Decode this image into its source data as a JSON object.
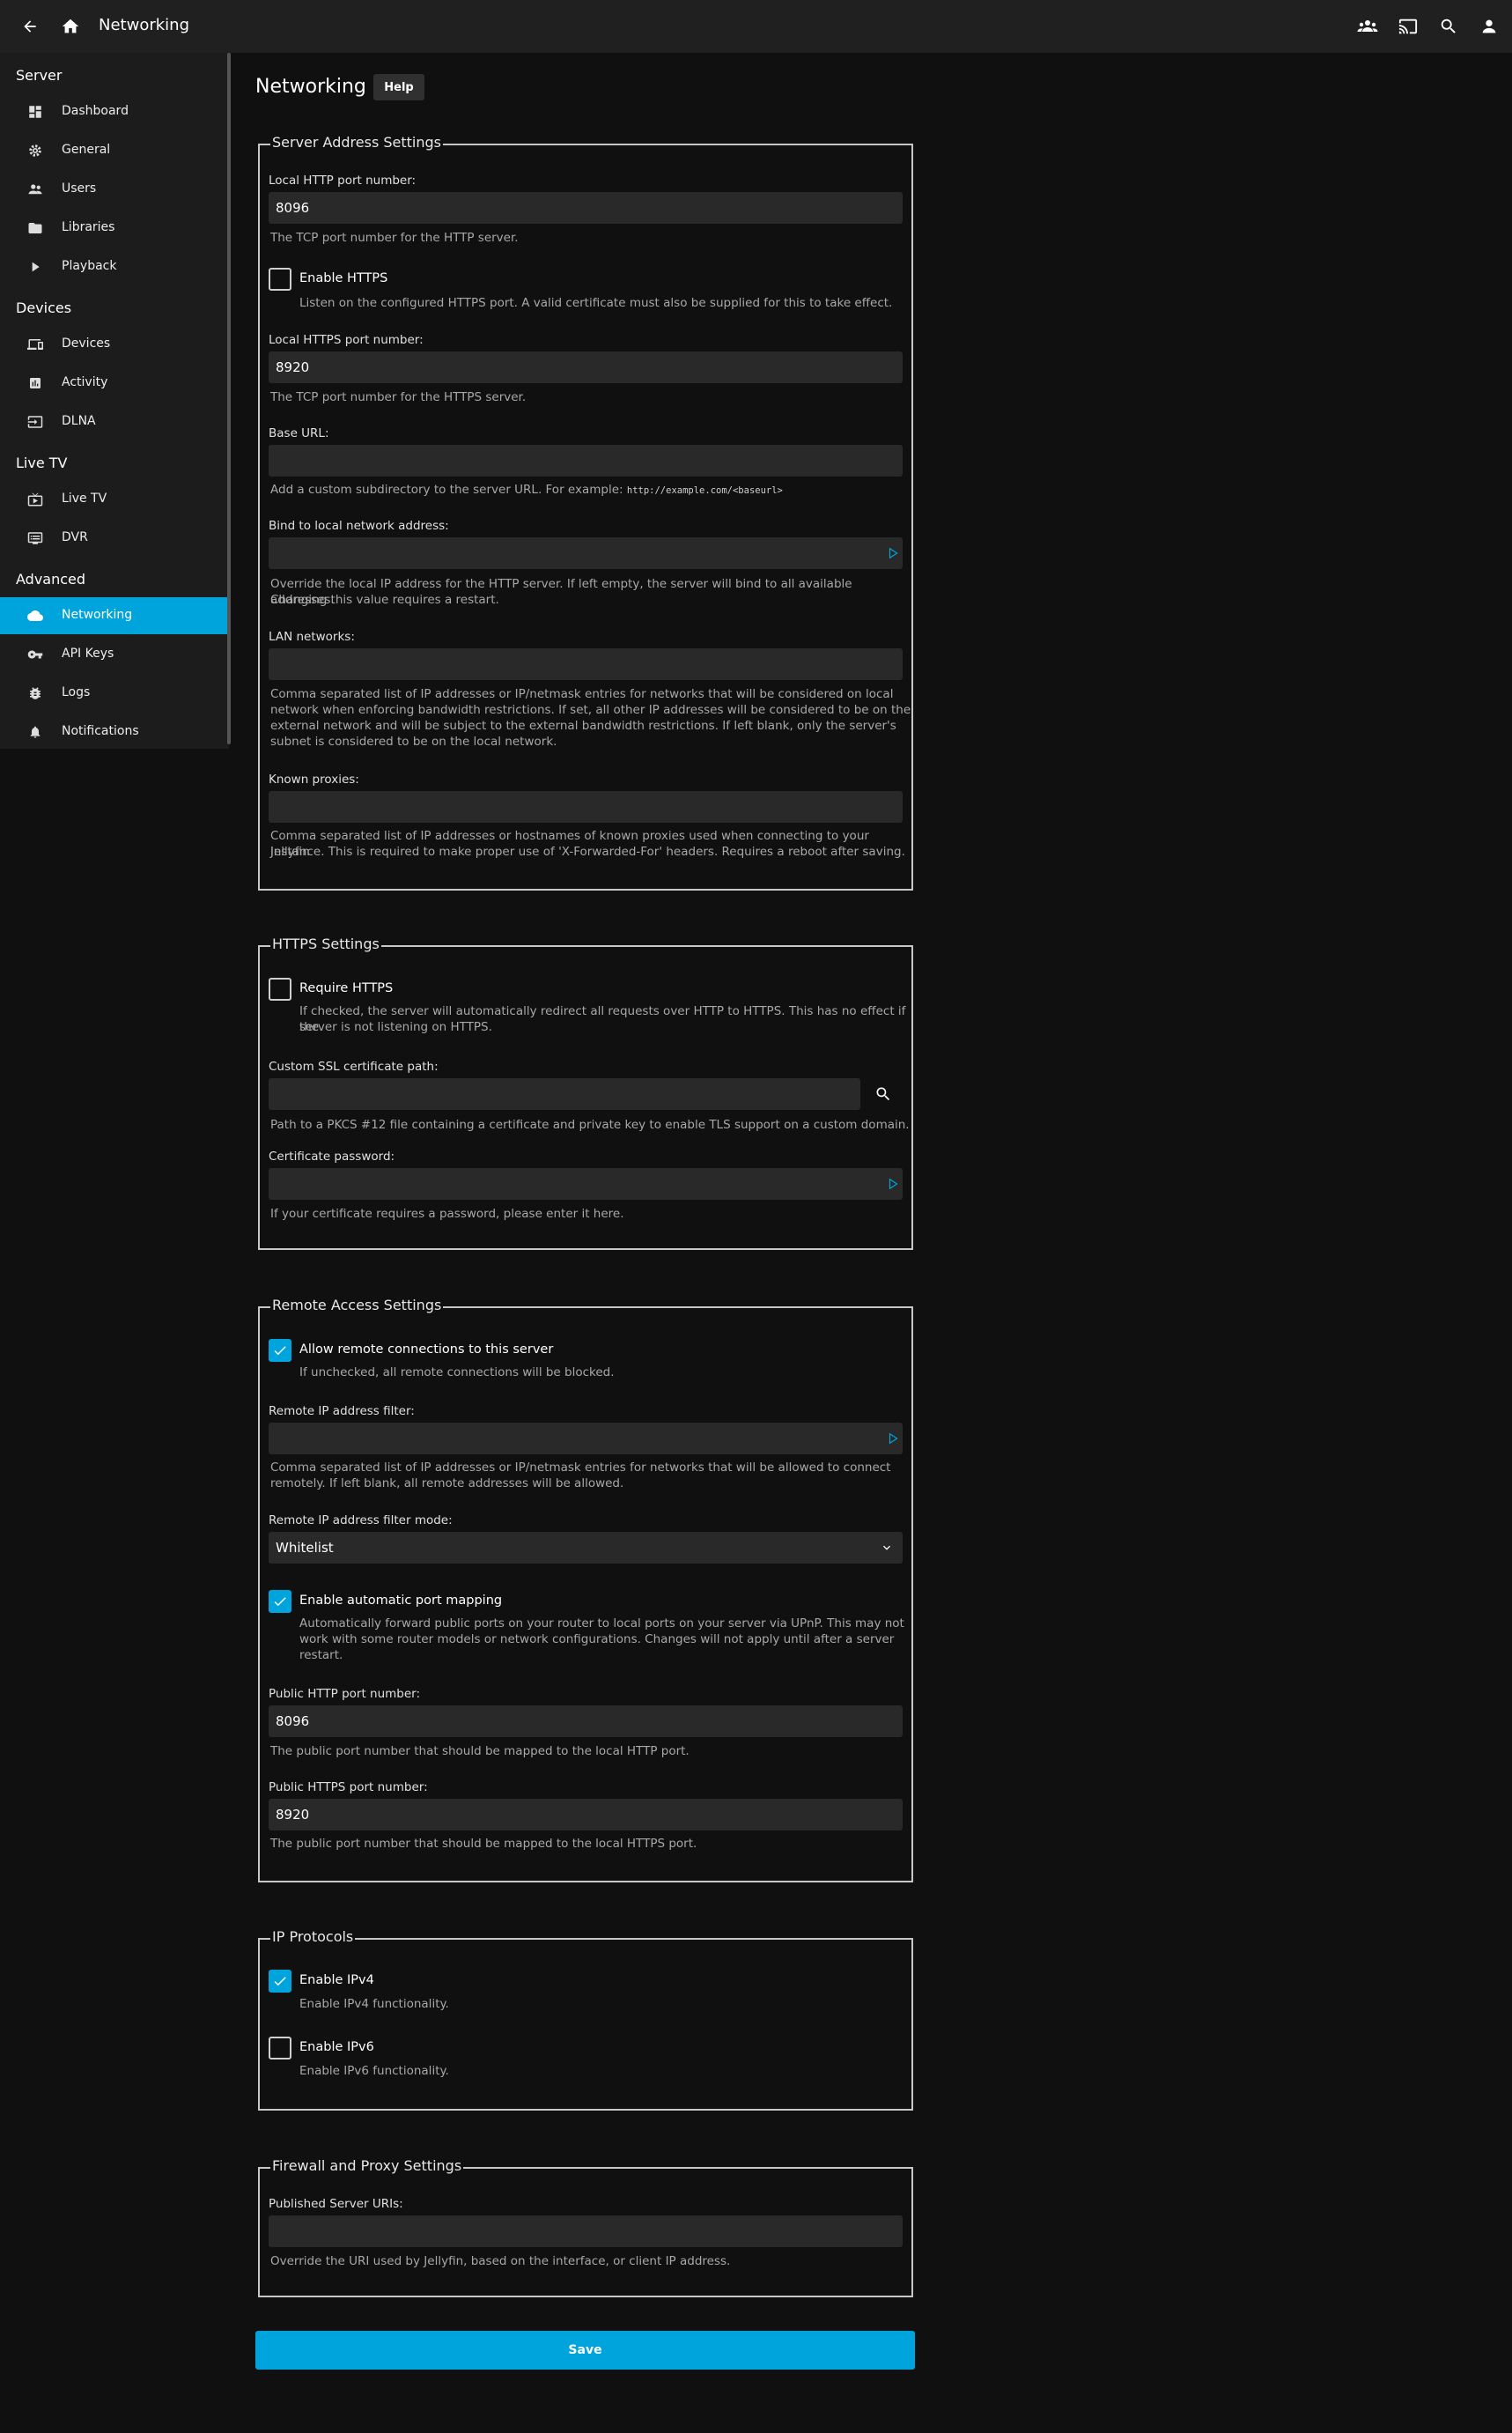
{
  "header": {
    "title": "Networking"
  },
  "sidebar": {
    "sections": [
      {
        "heading": "Server",
        "items": [
          "Dashboard",
          "General",
          "Users",
          "Libraries",
          "Playback"
        ]
      },
      {
        "heading": "Devices",
        "items": [
          "Devices",
          "Activity",
          "DLNA"
        ]
      },
      {
        "heading": "Live TV",
        "items": [
          "Live TV",
          "DVR"
        ]
      },
      {
        "heading": "Advanced",
        "items": [
          "Networking",
          "API Keys",
          "Logs",
          "Notifications"
        ]
      }
    ],
    "active": "Networking"
  },
  "page": {
    "title": "Networking",
    "help_label": "Help",
    "save_label": "Save"
  },
  "server_address": {
    "legend": "Server Address Settings",
    "http_port_label": "Local HTTP port number:",
    "http_port_value": "8096",
    "http_port_desc": "The TCP port number for the HTTP server.",
    "https_enable_label": "Enable HTTPS",
    "https_enable_desc": "Listen on the configured HTTPS port. A valid certificate must also be supplied for this to take effect.",
    "https_port_label": "Local HTTPS port number:",
    "https_port_value": "8920",
    "https_port_desc": "The TCP port number for the HTTPS server.",
    "base_url_label": "Base URL:",
    "base_url_desc": "Add a custom subdirectory to the server URL. For example:",
    "base_url_example": "http://example.com/<baseurl>",
    "bind_label": "Bind to local network address:",
    "bind_desc_1": "Override the local IP address for the HTTP server. If left empty, the server will bind to all available addresses.",
    "bind_desc_2": "Changing this value requires a restart.",
    "lan_label": "LAN networks:",
    "lan_desc_1": "Comma separated list of IP addresses or IP/netmask entries for networks that will be considered on local",
    "lan_desc_2": "network when enforcing bandwidth restrictions. If set, all other IP addresses will be considered to be on the",
    "lan_desc_3": "external network and will be subject to the external bandwidth restrictions. If left blank, only the server's",
    "lan_desc_4": "subnet is considered to be on the local network.",
    "proxies_label": "Known proxies:",
    "proxies_desc_1": "Comma separated list of IP addresses or hostnames of known proxies used when connecting to your Jellyfin",
    "proxies_desc_2": "instance. This is required to make proper use of 'X-Forwarded-For' headers. Requires a reboot after saving."
  },
  "https": {
    "legend": "HTTPS Settings",
    "require_label": "Require HTTPS",
    "require_desc_1": "If checked, the server will automatically redirect all requests over HTTP to HTTPS. This has no effect if the",
    "require_desc_2": "server is not listening on HTTPS.",
    "cert_path_label": "Custom SSL certificate path:",
    "cert_path_desc": "Path to a PKCS #12 file containing a certificate and private key to enable TLS support on a custom domain.",
    "cert_pass_label": "Certificate password:",
    "cert_pass_desc": "If your certificate requires a password, please enter it here."
  },
  "remote": {
    "legend": "Remote Access Settings",
    "allow_label": "Allow remote connections to this server",
    "allow_desc": "If unchecked, all remote connections will be blocked.",
    "filter_label": "Remote IP address filter:",
    "filter_desc_1": "Comma separated list of IP addresses or IP/netmask entries for networks that will be allowed to connect",
    "filter_desc_2": "remotely. If left blank, all remote addresses will be allowed.",
    "mode_label": "Remote IP address filter mode:",
    "mode_value": "Whitelist",
    "upnp_label": "Enable automatic port mapping",
    "upnp_desc_1": "Automatically forward public ports on your router to local ports on your server via UPnP. This may not",
    "upnp_desc_2": "work with some router models or network configurations. Changes will not apply until after a server",
    "upnp_desc_3": "restart.",
    "pub_http_label": "Public HTTP port number:",
    "pub_http_value": "8096",
    "pub_http_desc": "The public port number that should be mapped to the local HTTP port.",
    "pub_https_label": "Public HTTPS port number:",
    "pub_https_value": "8920",
    "pub_https_desc": "The public port number that should be mapped to the local HTTPS port."
  },
  "ip": {
    "legend": "IP Protocols",
    "ipv4_label": "Enable IPv4",
    "ipv4_desc": "Enable IPv4 functionality.",
    "ipv6_label": "Enable IPv6",
    "ipv6_desc": "Enable IPv6 functionality."
  },
  "firewall": {
    "legend": "Firewall and Proxy Settings",
    "uris_label": "Published Server URIs:",
    "uris_desc": "Override the URI used by Jellyfin, based on the interface, or client IP address."
  },
  "colors": {
    "accent": "#00a4dc",
    "background": "#101010",
    "header": "#202020",
    "input": "#292929"
  }
}
